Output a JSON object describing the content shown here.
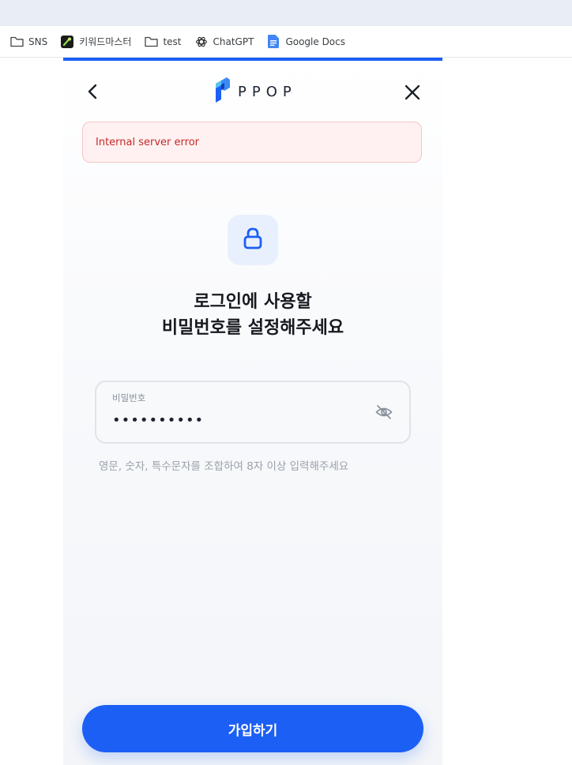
{
  "browser": {
    "bookmarks": [
      {
        "label": "SNS",
        "icon": "folder-icon"
      },
      {
        "label": "키워드마스터",
        "icon": "keyword-master-icon"
      },
      {
        "label": "test",
        "icon": "folder-icon"
      },
      {
        "label": "ChatGPT",
        "icon": "chatgpt-icon"
      },
      {
        "label": "Google Docs",
        "icon": "google-docs-icon"
      }
    ]
  },
  "header": {
    "logo_text": "PPOP",
    "back_icon": "chevron-left-icon",
    "close_icon": "close-icon",
    "progress": 1.0
  },
  "alert": {
    "message": "Internal server error"
  },
  "main": {
    "lock_icon": "lock-icon",
    "title_line1": "로그인에 사용할",
    "title_line2": "비밀번호를 설정해주세요",
    "password_field": {
      "label": "비밀번호",
      "value": "••••••••••",
      "visibility_icon": "eye-off-icon"
    },
    "hint": "영문, 숫자, 특수문자를 조합하여 8자 이상 입력해주세요",
    "submit_label": "가입하기"
  },
  "colors": {
    "accent": "#1c5ff5",
    "error_text": "#c62828",
    "error_bg": "#fff1f1"
  }
}
